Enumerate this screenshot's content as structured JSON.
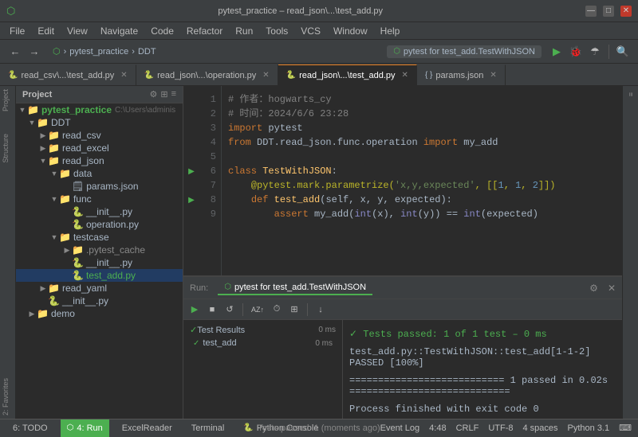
{
  "titleBar": {
    "title": "pytest_practice – read_json\\...\\test_add.py",
    "minimize": "—",
    "maximize": "□",
    "close": "✕"
  },
  "menuBar": {
    "items": [
      "File",
      "Edit",
      "View",
      "Navigate",
      "Code",
      "Refactor",
      "Run",
      "Tools",
      "VCS",
      "Window",
      "Help"
    ]
  },
  "toolbar": {
    "breadcrumb1": "pytest_practice",
    "breadcrumb2": "DDT",
    "runConfig": "pytest for test_add.TestWithJSON",
    "runIcon": "▶",
    "debugIcon": "🐛"
  },
  "tabs": [
    {
      "label": "read_csv\\...\\test_add.py",
      "active": false,
      "modified": false
    },
    {
      "label": "read_json\\...\\operation.py",
      "active": false,
      "modified": false
    },
    {
      "label": "read_json\\...\\test_add.py",
      "active": true,
      "modified": false
    },
    {
      "label": "params.json",
      "active": false,
      "modified": false
    }
  ],
  "projectPanel": {
    "title": "Project",
    "root": {
      "label": "pytest_practice",
      "path": "C:\\Users\\adminis",
      "children": [
        {
          "label": "DDT",
          "type": "folder",
          "expanded": true,
          "children": [
            {
              "label": "read_csv",
              "type": "folder",
              "expanded": false
            },
            {
              "label": "read_excel",
              "type": "folder",
              "expanded": false
            },
            {
              "label": "read_json",
              "type": "folder",
              "expanded": true,
              "children": [
                {
                  "label": "data",
                  "type": "folder",
                  "expanded": true,
                  "children": [
                    {
                      "label": "params.json",
                      "type": "json"
                    }
                  ]
                },
                {
                  "label": "func",
                  "type": "folder",
                  "expanded": true,
                  "children": [
                    {
                      "label": "__init__.py",
                      "type": "py"
                    },
                    {
                      "label": "operation.py",
                      "type": "py"
                    }
                  ]
                },
                {
                  "label": "testcase",
                  "type": "folder",
                  "expanded": true,
                  "children": [
                    {
                      "label": ".pytest_cache",
                      "type": "folder",
                      "expanded": false
                    },
                    {
                      "label": "__init__.py",
                      "type": "py"
                    },
                    {
                      "label": "test_add.py",
                      "type": "py",
                      "selected": true
                    }
                  ]
                }
              ]
            },
            {
              "label": "read_yaml",
              "type": "folder",
              "expanded": false
            },
            {
              "label": "__init__.py",
              "type": "py"
            }
          ]
        },
        {
          "label": "demo",
          "type": "folder",
          "expanded": false
        }
      ]
    }
  },
  "codeEditor": {
    "lines": [
      {
        "num": "1",
        "gutter": "",
        "content": [
          {
            "text": "# ",
            "cls": "comment"
          },
          {
            "text": "作者：hogwarts_cy",
            "cls": "comment"
          }
        ]
      },
      {
        "num": "2",
        "gutter": "",
        "content": [
          {
            "text": "# ",
            "cls": "comment"
          },
          {
            "text": "时间：2024/6/6 23:28",
            "cls": "comment"
          }
        ]
      },
      {
        "num": "3",
        "gutter": "",
        "content": [
          {
            "text": "import ",
            "cls": "kw-import"
          },
          {
            "text": "pytest",
            "cls": "import-name"
          }
        ]
      },
      {
        "num": "4",
        "gutter": "",
        "content": [
          {
            "text": "from ",
            "cls": "kw-from"
          },
          {
            "text": "DDT.read_json.func.operation ",
            "cls": "import-name"
          },
          {
            "text": "import ",
            "cls": "kw-import"
          },
          {
            "text": "my_add",
            "cls": "import-name"
          }
        ]
      },
      {
        "num": "5",
        "gutter": "",
        "content": []
      },
      {
        "num": "6",
        "gutter": "▶",
        "content": [
          {
            "text": "class ",
            "cls": "kw-class"
          },
          {
            "text": "TestWithJSON",
            "cls": "class-name"
          },
          {
            "text": ":",
            "cls": "operator"
          }
        ]
      },
      {
        "num": "7",
        "gutter": "",
        "content": [
          {
            "text": "    @pytest.mark.parametrize(",
            "cls": "decorator"
          },
          {
            "text": "'x,y,expected'",
            "cls": "string"
          },
          {
            "text": ", [[",
            "cls": "operator"
          },
          {
            "text": "1",
            "cls": "number"
          },
          {
            "text": ", ",
            "cls": "operator"
          },
          {
            "text": "1",
            "cls": "number"
          },
          {
            "text": ", ",
            "cls": "operator"
          },
          {
            "text": "2",
            "cls": "number"
          },
          {
            "text": "]])",
            "cls": "operator"
          }
        ]
      },
      {
        "num": "8",
        "gutter": "▶",
        "content": [
          {
            "text": "    ",
            "cls": ""
          },
          {
            "text": "def ",
            "cls": "kw-def"
          },
          {
            "text": "test_add",
            "cls": "func-name"
          },
          {
            "text": "(",
            "cls": "operator"
          },
          {
            "text": "self",
            "cls": "kw-self"
          },
          {
            "text": ", x, y, expected):",
            "cls": "param"
          }
        ]
      },
      {
        "num": "9",
        "gutter": "",
        "content": [
          {
            "text": "        ",
            "cls": ""
          },
          {
            "text": "assert ",
            "cls": "kw-assert"
          },
          {
            "text": "my_add(",
            "cls": "import-name"
          },
          {
            "text": "int",
            "cls": "builtin"
          },
          {
            "text": "(x), ",
            "cls": "operator"
          },
          {
            "text": "int",
            "cls": "builtin"
          },
          {
            "text": "(y)) == ",
            "cls": "operator"
          },
          {
            "text": "int",
            "cls": "builtin"
          },
          {
            "text": "(expected)",
            "cls": "operator"
          }
        ]
      }
    ]
  },
  "runPanel": {
    "tabLabel": "pytest for test_add.TestWithJSON",
    "closeLabel": "✕",
    "toolbar": {
      "rerun": "▶",
      "stop": "■",
      "rerunFailed": "↺",
      "sortAlpha": "AZ",
      "sortDuration": "⏱",
      "expandAll": "⊞",
      "settings": "⚙",
      "scrollToEnd": "↓"
    },
    "testResults": {
      "header": "Test Results",
      "headerTime": "0 ms",
      "items": [
        {
          "label": "test_add",
          "time": "0 ms",
          "pass": true
        }
      ]
    },
    "output": {
      "line1": "test_add.py::TestWithJSON::test_add[1-1-2] PASSED                        [100%]",
      "line2": "",
      "line3": "=========================== 1 passed in 0.02s ============================",
      "line4": "",
      "line5": "Process finished with exit code 0"
    }
  },
  "statusBar": {
    "testsPassed": "Tests passed: 1 (moments ago)",
    "tabs": [
      "6: TODO",
      "4: Run",
      "ExcelReader",
      "Terminal",
      "Python Console"
    ],
    "activeTab": "4: Run",
    "right": {
      "line": "4:48",
      "encoding": "CRLF",
      "charset": "UTF-8",
      "spaces": "4 spaces",
      "python": "Python 3.1",
      "eventLog": "Event Log"
    }
  }
}
